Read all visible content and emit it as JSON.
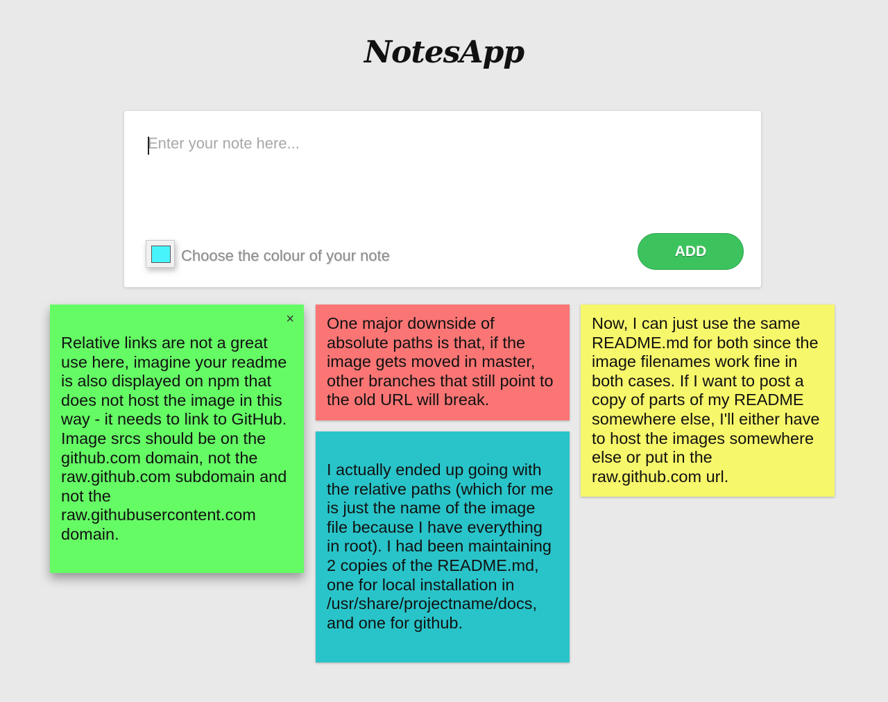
{
  "app": {
    "title": "NotesApp"
  },
  "composer": {
    "placeholder": "Enter your note here...",
    "value": "",
    "colour_label": "Choose the colour of your note",
    "selected_colour": "#48f4fb",
    "add_label": "ADD"
  },
  "notes": [
    {
      "colour": "#65fb65",
      "close_icon": "×",
      "text": "Relative links are not a great use here, imagine your readme is also displayed on npm that does not host the image in this way - it needs to link to GitHub. Image srcs should be on the github.com domain, not the raw.github.com subdomain and not the raw.githubusercontent.com domain."
    },
    {
      "colour": "#fb7575",
      "text": "One major downside of absolute paths is that, if the image gets moved in master, other branches that still point to the old URL will break."
    },
    {
      "colour": "#29c4c9",
      "text": "I actually ended up going with the relative paths (which for me is just the name of the image file because I have everything in root). I had been maintaining 2 copies of the README.md, one for local installation in /usr/share/projectname/docs, and one for github."
    },
    {
      "colour": "#f7f76b",
      "text": "Now, I can just use the same README.md for both since the image filenames work fine in both cases. If I want to post a copy of parts of my README somewhere else, I'll either have to host the images somewhere else or put in the raw.github.com url."
    }
  ]
}
